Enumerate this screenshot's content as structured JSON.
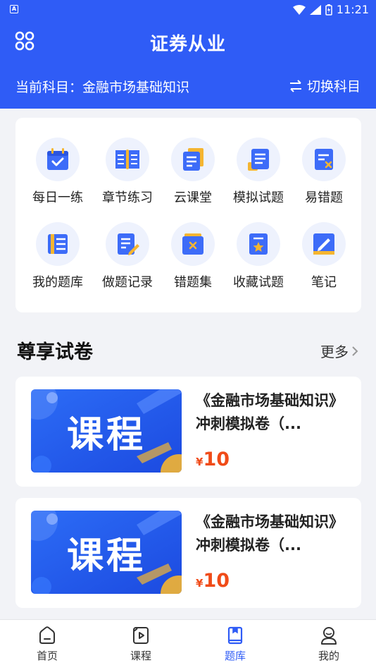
{
  "status": {
    "time": "11:21",
    "colors": {
      "brand": "#2f5cf6"
    }
  },
  "header": {
    "title": "证券从业",
    "menu_icon": "grid-menu-icon"
  },
  "subject": {
    "current": "当前科目：金融市场基础知识",
    "switch_label": "切换科目"
  },
  "grid": [
    {
      "label": "每日一练",
      "icon": "calendar-check-icon"
    },
    {
      "label": "章节练习",
      "icon": "open-book-icon"
    },
    {
      "label": "云课堂",
      "icon": "document-icon"
    },
    {
      "label": "模拟试题",
      "icon": "exam-paper-icon"
    },
    {
      "label": "易错题",
      "icon": "error-sheet-icon"
    },
    {
      "label": "我的题库",
      "icon": "book-stack-icon"
    },
    {
      "label": "做题记录",
      "icon": "edit-record-icon"
    },
    {
      "label": "错题集",
      "icon": "wrong-folder-icon"
    },
    {
      "label": "收藏试题",
      "icon": "star-doc-icon"
    },
    {
      "label": "笔记",
      "icon": "notebook-pen-icon"
    }
  ],
  "section": {
    "title": "尊享试卷",
    "more": "更多"
  },
  "courses": [
    {
      "thumb_text": "课程",
      "name": "《金融市场基础知识》冲刺模拟卷（...",
      "currency": "¥",
      "price": "10"
    },
    {
      "thumb_text": "课程",
      "name": "《金融市场基础知识》冲刺模拟卷（...",
      "currency": "¥",
      "price": "10"
    }
  ],
  "tabs": [
    {
      "label": "首页",
      "icon": "home-icon",
      "active": false
    },
    {
      "label": "课程",
      "icon": "video-icon",
      "active": false
    },
    {
      "label": "题库",
      "icon": "question-bank-icon",
      "active": true
    },
    {
      "label": "我的",
      "icon": "profile-icon",
      "active": false
    }
  ]
}
